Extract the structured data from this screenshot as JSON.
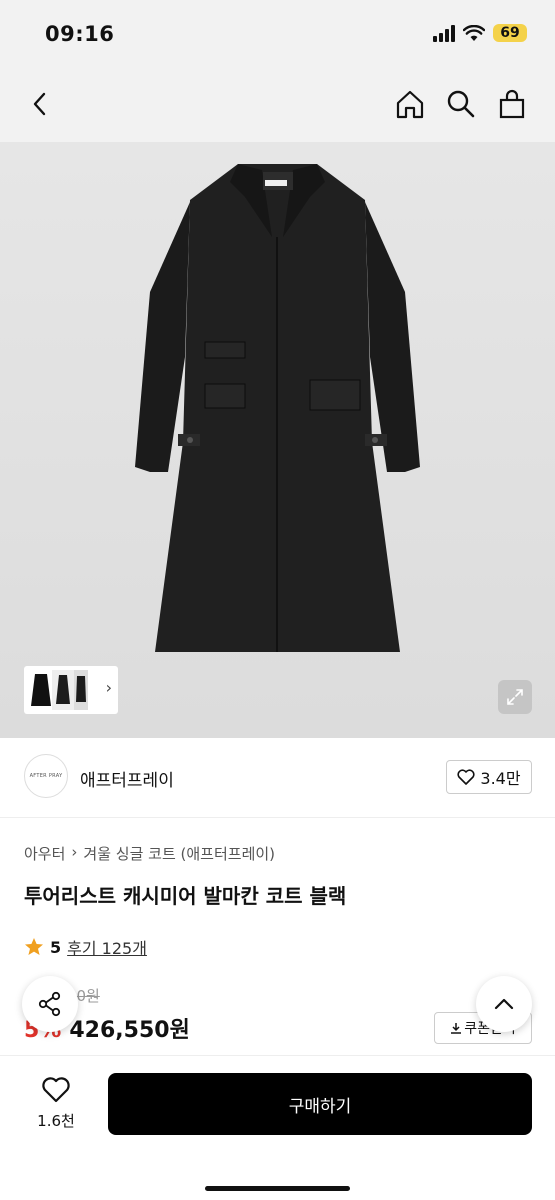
{
  "status": {
    "time": "09:16",
    "battery": "69"
  },
  "nav": {
    "back_icon": "chevron-left-icon",
    "home_icon": "home-icon",
    "search_icon": "search-icon",
    "bag_icon": "shopping-bag-icon"
  },
  "brand": {
    "name": "애프터프레이",
    "logo_text": "AFTER PRAY",
    "likes": "3.4만"
  },
  "breadcrumb": [
    "아우터",
    "겨울 싱글 코트 (애프터프레이)"
  ],
  "product": {
    "title": "투어리스트 캐시미어 발마칸 코트 블랙"
  },
  "rating": {
    "value": "5",
    "reviews": "후기 125개"
  },
  "price": {
    "original": "449,000원",
    "discount": "5%",
    "sale": "426,550원",
    "coupon_label": "쿠폰받기"
  },
  "bottom": {
    "wish_count": "1.6천",
    "buy_label": "구매하기"
  },
  "colors": {
    "accent_red": "#e0322a",
    "star": "#f0a020",
    "battery": "#f4d24a"
  }
}
